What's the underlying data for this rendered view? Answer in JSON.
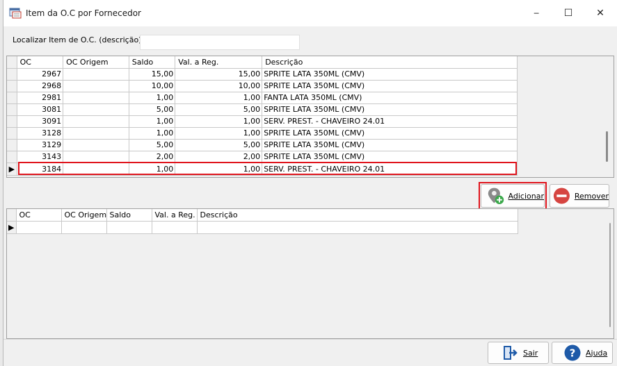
{
  "window": {
    "title": "Item da O.C por Fornecedor",
    "minimize_glyph": "─",
    "maximize_glyph": "☐",
    "close_glyph": "✕"
  },
  "search": {
    "label": "Localizar Item de O.C. (descrição):",
    "value": ""
  },
  "upper_grid": {
    "columns": [
      "OC",
      "OC Origem",
      "Saldo",
      "Val. a Reg.",
      "Descrição"
    ],
    "rows": [
      {
        "oc": "2967",
        "oc_origem": "",
        "saldo": "15,00",
        "val_reg": "15,00",
        "descricao": "SPRITE LATA 350ML (CMV)"
      },
      {
        "oc": "2968",
        "oc_origem": "",
        "saldo": "10,00",
        "val_reg": "10,00",
        "descricao": "SPRITE LATA 350ML (CMV)"
      },
      {
        "oc": "2981",
        "oc_origem": "",
        "saldo": "1,00",
        "val_reg": "1,00",
        "descricao": "FANTA LATA 350ML (CMV)"
      },
      {
        "oc": "3081",
        "oc_origem": "",
        "saldo": "5,00",
        "val_reg": "5,00",
        "descricao": "SPRITE LATA 350ML (CMV)"
      },
      {
        "oc": "3091",
        "oc_origem": "",
        "saldo": "1,00",
        "val_reg": "1,00",
        "descricao": "SERV. PREST. - CHAVEIRO 24.01"
      },
      {
        "oc": "3128",
        "oc_origem": "",
        "saldo": "1,00",
        "val_reg": "1,00",
        "descricao": "SPRITE LATA 350ML (CMV)"
      },
      {
        "oc": "3129",
        "oc_origem": "",
        "saldo": "5,00",
        "val_reg": "5,00",
        "descricao": "SPRITE LATA 350ML (CMV)"
      },
      {
        "oc": "3143",
        "oc_origem": "",
        "saldo": "2,00",
        "val_reg": "2,00",
        "descricao": "SPRITE LATA 350ML (CMV)"
      },
      {
        "oc": "3184",
        "oc_origem": "",
        "saldo": "1,00",
        "val_reg": "1,00",
        "descricao": "SERV. PREST. - CHAVEIRO 24.01"
      }
    ],
    "selected_row_index": 8
  },
  "actions": {
    "add_label": "Adicionar",
    "remove_label": "Remover"
  },
  "lower_grid": {
    "columns": [
      "OC",
      "OC Origem",
      "Saldo",
      "Val. a Reg.",
      "Descrição"
    ]
  },
  "footer": {
    "exit_label": "Sair",
    "help_label": "Ajuda"
  },
  "colors": {
    "highlight": "#e0141c",
    "add_icon_green": "#3aa84a",
    "remove_icon_red": "#d64541",
    "help_icon_blue": "#1e5aa8"
  }
}
